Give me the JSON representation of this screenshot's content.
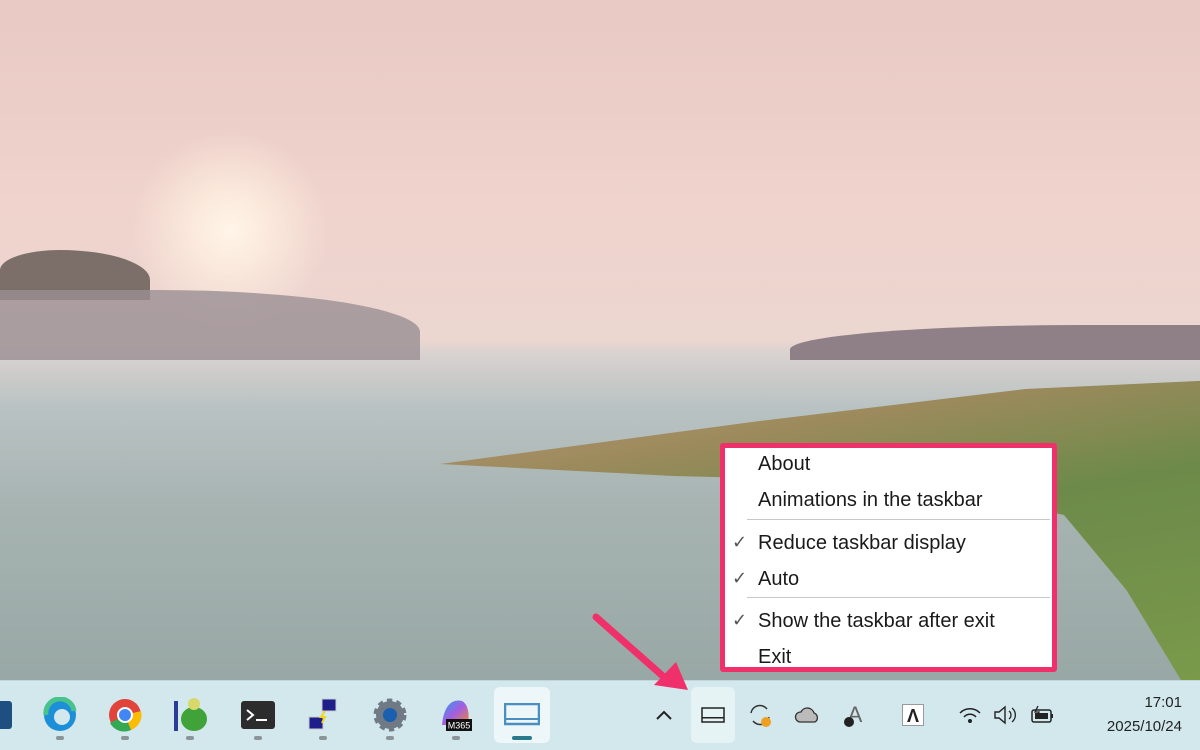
{
  "menu": {
    "items": [
      {
        "label": "About",
        "checked": false
      },
      {
        "label": "Animations in the taskbar",
        "checked": false
      },
      {
        "label": "Reduce taskbar display",
        "checked": true
      },
      {
        "label": "Auto",
        "checked": true
      },
      {
        "label": "Show the taskbar after exit",
        "checked": true
      },
      {
        "label": "Exit",
        "checked": false
      }
    ],
    "check_glyph": "✓"
  },
  "taskbar": {
    "apps": [
      "partial-app",
      "edge",
      "chrome",
      "tortoise-app",
      "terminal",
      "network-app",
      "settings",
      "microsoft-365",
      "taskbar-tool"
    ],
    "m365_badge": "M365",
    "tray": {
      "chevron": "^",
      "a_icon": "A",
      "lambda_icon": "Λ"
    },
    "clock": {
      "time": "17:01",
      "date": "2025/10/24"
    }
  },
  "colors": {
    "highlight": "#f0306a",
    "taskbar": "#d2e8ec"
  }
}
